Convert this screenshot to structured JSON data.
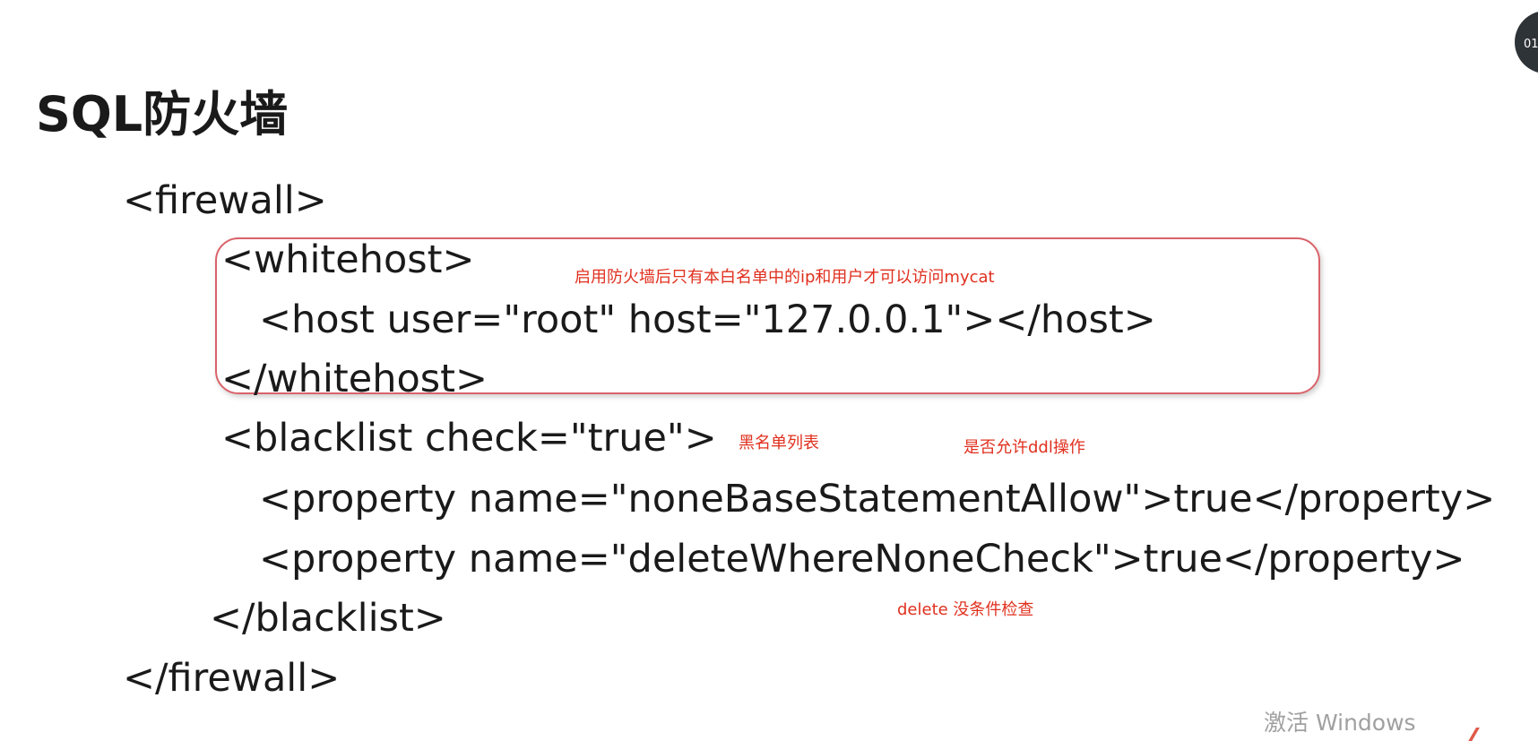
{
  "slide": {
    "heading": "SQL防火墙",
    "code_lines": [
      "<firewall>",
      "<whitehost>",
      "<host user=\"root\" host=\"127.0.0.1\"></host>",
      "</whitehost>",
      "<blacklist check=\"true\">",
      "<property name=\"noneBaseStatementAllow\">true</property>",
      "<property name=\"deleteWhereNoneCheck\">true</property>",
      "</blacklist>",
      "</firewall>"
    ],
    "annotations": {
      "whitehost_note": "启用防火墙后只有本白名单中的ip和用户才可以访问mycat",
      "blacklist_note": "黑名单列表",
      "ddl_note": "是否允许ddl操作",
      "delete_note": "delete 没条件检查"
    },
    "colors": {
      "annotation": "#e0301e",
      "frame_border": "#d9636a",
      "code_text": "#1a1a1a"
    }
  },
  "overlay": {
    "watermark_text": "激活 Windows"
  }
}
